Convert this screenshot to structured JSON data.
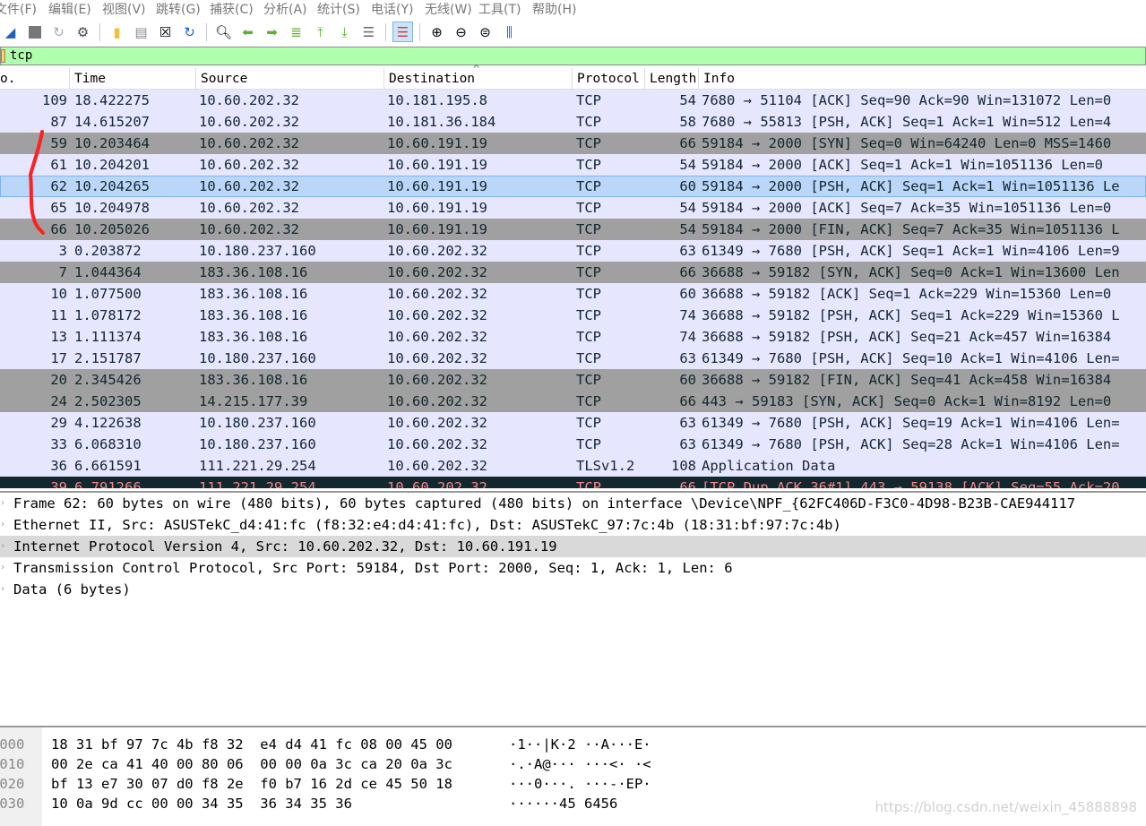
{
  "menu": [
    "文件(F)",
    "编辑(E)",
    "视图(V)",
    "跳转(G)",
    "捕获(C)",
    "分析(A)",
    "统计(S)",
    "电话(Y)",
    "无线(W)",
    "工具(T)",
    "帮助(H)"
  ],
  "filter": {
    "value": "tcp"
  },
  "columns": [
    "o.",
    "Time",
    "Source",
    "Destination",
    "Protocol",
    "Length",
    "Info"
  ],
  "packets": [
    {
      "no": "109",
      "time": "18.422275",
      "src": "10.60.202.32",
      "dst": "10.181.195.8",
      "proto": "TCP",
      "len": "54",
      "info": "7680 → 51104 [ACK] Seq=90 Ack=90 Win=131072 Len=0",
      "style": "light"
    },
    {
      "no": "87",
      "time": "14.615207",
      "src": "10.60.202.32",
      "dst": "10.181.36.184",
      "proto": "TCP",
      "len": "58",
      "info": "7680 → 55813 [PSH, ACK] Seq=1 Ack=1 Win=512 Len=4",
      "style": "light"
    },
    {
      "no": "59",
      "time": "10.203464",
      "src": "10.60.202.32",
      "dst": "10.60.191.19",
      "proto": "TCP",
      "len": "66",
      "info": "59184 → 2000 [SYN] Seq=0 Win=64240 Len=0 MSS=1460",
      "style": "gray"
    },
    {
      "no": "61",
      "time": "10.204201",
      "src": "10.60.202.32",
      "dst": "10.60.191.19",
      "proto": "TCP",
      "len": "54",
      "info": "59184 → 2000 [ACK] Seq=1 Ack=1 Win=1051136 Len=0",
      "style": "light"
    },
    {
      "no": "62",
      "time": "10.204265",
      "src": "10.60.202.32",
      "dst": "10.60.191.19",
      "proto": "TCP",
      "len": "60",
      "info": "59184 → 2000 [PSH, ACK] Seq=1 Ack=1 Win=1051136 Le",
      "style": "sel"
    },
    {
      "no": "65",
      "time": "10.204978",
      "src": "10.60.202.32",
      "dst": "10.60.191.19",
      "proto": "TCP",
      "len": "54",
      "info": "59184 → 2000 [ACK] Seq=7 Ack=35 Win=1051136 Len=0",
      "style": "light"
    },
    {
      "no": "66",
      "time": "10.205026",
      "src": "10.60.202.32",
      "dst": "10.60.191.19",
      "proto": "TCP",
      "len": "54",
      "info": "59184 → 2000 [FIN, ACK] Seq=7 Ack=35 Win=1051136 L",
      "style": "gray"
    },
    {
      "no": "3",
      "time": "0.203872",
      "src": "10.180.237.160",
      "dst": "10.60.202.32",
      "proto": "TCP",
      "len": "63",
      "info": "61349 → 7680 [PSH, ACK] Seq=1 Ack=1 Win=4106 Len=9",
      "style": "light"
    },
    {
      "no": "7",
      "time": "1.044364",
      "src": "183.36.108.16",
      "dst": "10.60.202.32",
      "proto": "TCP",
      "len": "66",
      "info": "36688 → 59182 [SYN, ACK] Seq=0 Ack=1 Win=13600 Len",
      "style": "gray"
    },
    {
      "no": "10",
      "time": "1.077500",
      "src": "183.36.108.16",
      "dst": "10.60.202.32",
      "proto": "TCP",
      "len": "60",
      "info": "36688 → 59182 [ACK] Seq=1 Ack=229 Win=15360 Len=0",
      "style": "light"
    },
    {
      "no": "11",
      "time": "1.078172",
      "src": "183.36.108.16",
      "dst": "10.60.202.32",
      "proto": "TCP",
      "len": "74",
      "info": "36688 → 59182 [PSH, ACK] Seq=1 Ack=229 Win=15360 L",
      "style": "light"
    },
    {
      "no": "13",
      "time": "1.111374",
      "src": "183.36.108.16",
      "dst": "10.60.202.32",
      "proto": "TCP",
      "len": "74",
      "info": "36688 → 59182 [PSH, ACK] Seq=21 Ack=457 Win=16384",
      "style": "light"
    },
    {
      "no": "17",
      "time": "2.151787",
      "src": "10.180.237.160",
      "dst": "10.60.202.32",
      "proto": "TCP",
      "len": "63",
      "info": "61349 → 7680 [PSH, ACK] Seq=10 Ack=1 Win=4106 Len=",
      "style": "light"
    },
    {
      "no": "20",
      "time": "2.345426",
      "src": "183.36.108.16",
      "dst": "10.60.202.32",
      "proto": "TCP",
      "len": "60",
      "info": "36688 → 59182 [FIN, ACK] Seq=41 Ack=458 Win=16384",
      "style": "gray"
    },
    {
      "no": "24",
      "time": "2.502305",
      "src": "14.215.177.39",
      "dst": "10.60.202.32",
      "proto": "TCP",
      "len": "66",
      "info": "443 → 59183 [SYN, ACK] Seq=0 Ack=1 Win=8192 Len=0",
      "style": "gray"
    },
    {
      "no": "29",
      "time": "4.122638",
      "src": "10.180.237.160",
      "dst": "10.60.202.32",
      "proto": "TCP",
      "len": "63",
      "info": "61349 → 7680 [PSH, ACK] Seq=19 Ack=1 Win=4106 Len=",
      "style": "light"
    },
    {
      "no": "33",
      "time": "6.068310",
      "src": "10.180.237.160",
      "dst": "10.60.202.32",
      "proto": "TCP",
      "len": "63",
      "info": "61349 → 7680 [PSH, ACK] Seq=28 Ack=1 Win=4106 Len=",
      "style": "light"
    },
    {
      "no": "36",
      "time": "6.661591",
      "src": "111.221.29.254",
      "dst": "10.60.202.32",
      "proto": "TLSv1.2",
      "len": "108",
      "info": "Application Data",
      "style": "light"
    },
    {
      "no": "39",
      "time": "6.791266",
      "src": "111.221.29.254",
      "dst": "10.60.202.32",
      "proto": "TCP",
      "len": "66",
      "info": "[TCP Dup ACK 36#1] 443 → 59138 [ACK] Seq=55 Ack=20",
      "style": "bad"
    }
  ],
  "details": [
    "Frame 62: 60 bytes on wire (480 bits), 60 bytes captured (480 bits) on interface \\Device\\NPF_{62FC406D-F3C0-4D98-B23B-CAE944117",
    "Ethernet II, Src: ASUSTekC_d4:41:fc (f8:32:e4:d4:41:fc), Dst: ASUSTekC_97:7c:4b (18:31:bf:97:7c:4b)",
    "Internet Protocol Version 4, Src: 10.60.202.32, Dst: 10.60.191.19",
    "Transmission Control Protocol, Src Port: 59184, Dst Port: 2000, Seq: 1, Ack: 1, Len: 6",
    "Data (6 bytes)"
  ],
  "hex": [
    {
      "off": "0000",
      "bytes": "18 31 bf 97 7c 4b f8 32  e4 d4 41 fc 08 00 45 00",
      "ascii": "·1··|K·2 ··A···E·"
    },
    {
      "off": "0010",
      "bytes": "00 2e ca 41 40 00 80 06  00 00 0a 3c ca 20 0a 3c",
      "ascii": "·.·A@··· ···<· ·<"
    },
    {
      "off": "0020",
      "bytes": "bf 13 e7 30 07 d0 f8 2e  f0 b7 16 2d ce 45 50 18",
      "ascii": "···0···. ···-·EP·"
    },
    {
      "off": "0030",
      "bytes": "10 0a 9d cc 00 00 34 35  36 34 35 36",
      "ascii": "······45 6456"
    }
  ],
  "watermark": "https://blog.csdn.net/weixin_45888898",
  "colors": {
    "light_row": "#e7e6ff",
    "gray_row": "#a0a0a0",
    "selected_row": "#bad6f9",
    "filter_ok": "#afffaf",
    "annotation": "#ff2020"
  }
}
